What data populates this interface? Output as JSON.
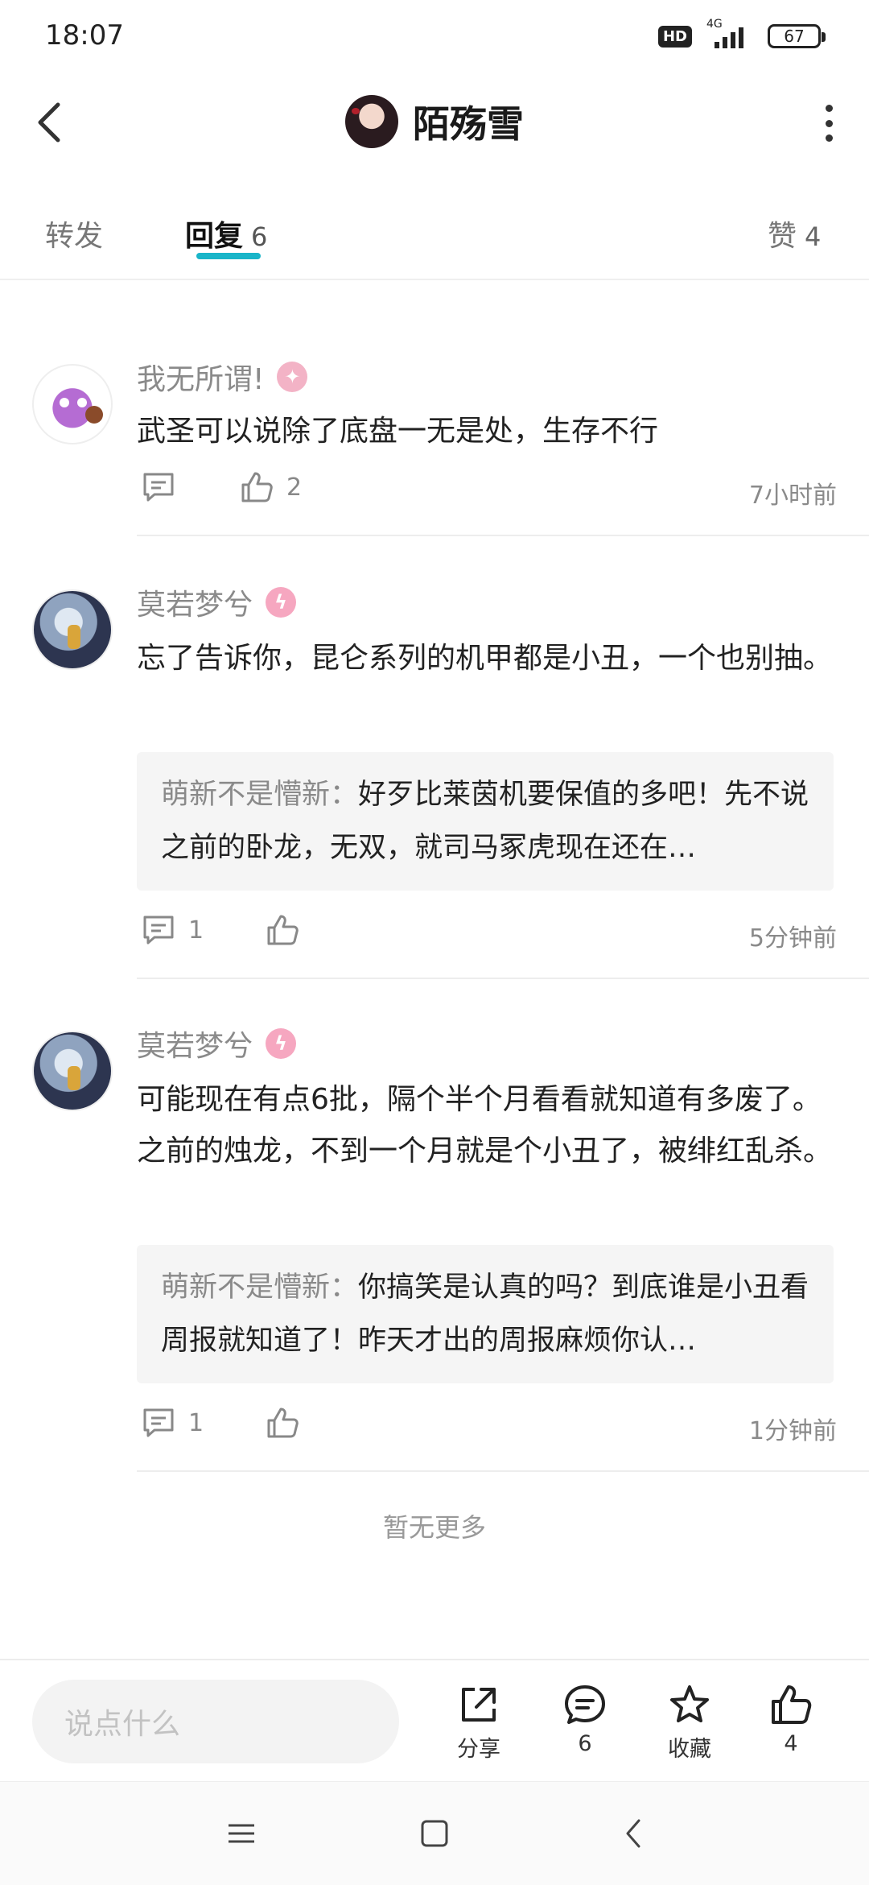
{
  "status_bar": {
    "time": "18:07",
    "hd": "HD",
    "network": "4G",
    "battery": "67"
  },
  "header": {
    "title": "陌殇雪"
  },
  "tabs": [
    {
      "label": "转发",
      "count": ""
    },
    {
      "label": "回复",
      "count": "6"
    },
    {
      "label": "赞",
      "count": "4"
    }
  ],
  "comments": [
    {
      "author": "我无所谓!",
      "body": "武圣可以说除了底盘一无是处，生存不行",
      "quote_author": "",
      "quote_text": "",
      "reply_count": "",
      "like_count": "2",
      "time": "7小时前"
    },
    {
      "author": "莫若梦兮",
      "body": "忘了告诉你，昆仑系列的机甲都是小丑，一个也别抽。",
      "quote_author": "萌新不是懵新",
      "quote_text": "好歹比莱茵机要保值的多吧！先不说之前的卧龙，无双，就司马冢虎现在还在…",
      "reply_count": "1",
      "like_count": "",
      "time": "5分钟前"
    },
    {
      "author": "莫若梦兮",
      "body": "可能现在有点6批，隔个半个月看看就知道有多废了。之前的烛龙，不到一个月就是个小丑了，被绯红乱杀。",
      "quote_author": "萌新不是懵新",
      "quote_text": "你搞笑是认真的吗？到底谁是小丑看周报就知道了！昨天才出的周报麻烦你认…",
      "reply_count": "1",
      "like_count": "",
      "time": "1分钟前"
    }
  ],
  "footer": {
    "no_more": "暂无更多"
  },
  "bottom_bar": {
    "input_placeholder": "说点什么",
    "share_label": "分享",
    "comment_count": "6",
    "favorite_label": "收藏",
    "like_count": "4"
  },
  "colors": {
    "accent": "#19b5c9",
    "badge_pink": "#f6a7c0",
    "muted_text": "#8a8a8a"
  }
}
